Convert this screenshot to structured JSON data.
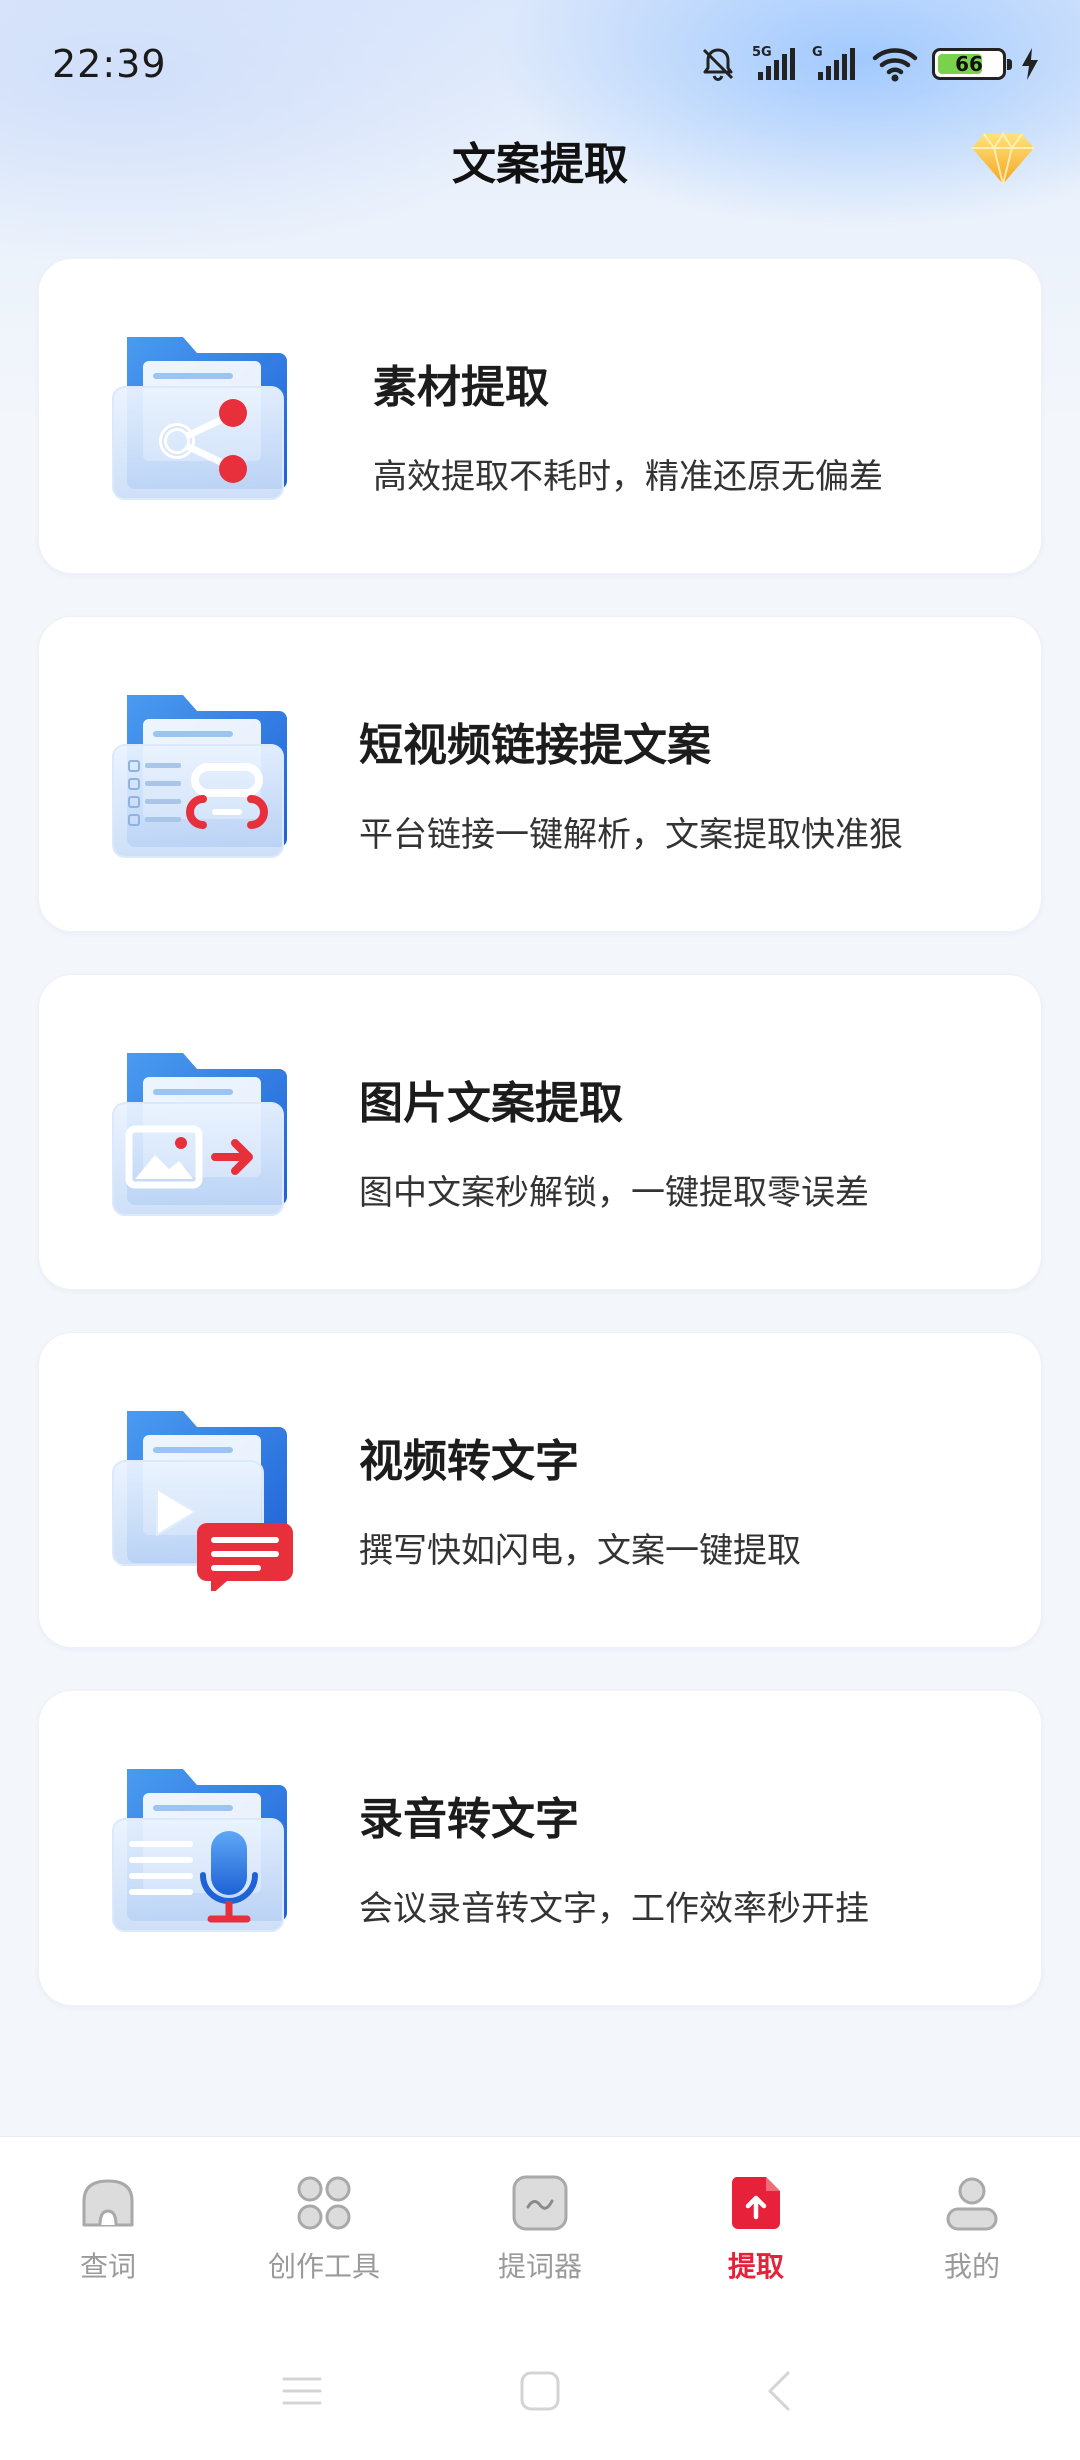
{
  "status_bar": {
    "time": "22:39",
    "battery": "66",
    "icons": [
      "mute-bell-icon",
      "signal-5g-icon",
      "signal-g-icon",
      "wifi-icon",
      "battery-icon",
      "charging-icon"
    ]
  },
  "header": {
    "title": "文案提取",
    "vip_icon": "diamond-icon"
  },
  "cards": [
    {
      "title": "素材提取",
      "desc": "高效提取不耗时，精准还原无偏差",
      "icon": "folder-link-icon"
    },
    {
      "title": "短视频链接提文案",
      "desc": "平台链接一键解析，文案提取快准狠",
      "icon": "folder-chain-icon"
    },
    {
      "title": "图片文案提取",
      "desc": "图中文案秒解锁，一键提取零误差",
      "icon": "folder-image-icon"
    },
    {
      "title": "视频转文字",
      "desc": "撰写快如闪电，文案一键提取",
      "icon": "folder-video-icon"
    },
    {
      "title": "录音转文字",
      "desc": "会议录音转文字，工作效率秒开挂",
      "icon": "folder-mic-icon"
    }
  ],
  "bottom_nav": {
    "active": "提取",
    "accent_color": "#e8213a",
    "items": [
      {
        "label": "查词",
        "icon": "home-icon"
      },
      {
        "label": "创作工具",
        "icon": "grid-icon"
      },
      {
        "label": "提词器",
        "icon": "prompter-icon"
      },
      {
        "label": "提取",
        "icon": "extract-icon"
      },
      {
        "label": "我的",
        "icon": "user-icon"
      }
    ]
  },
  "system_nav": [
    "menu-icon",
    "home-square-icon",
    "back-icon"
  ]
}
